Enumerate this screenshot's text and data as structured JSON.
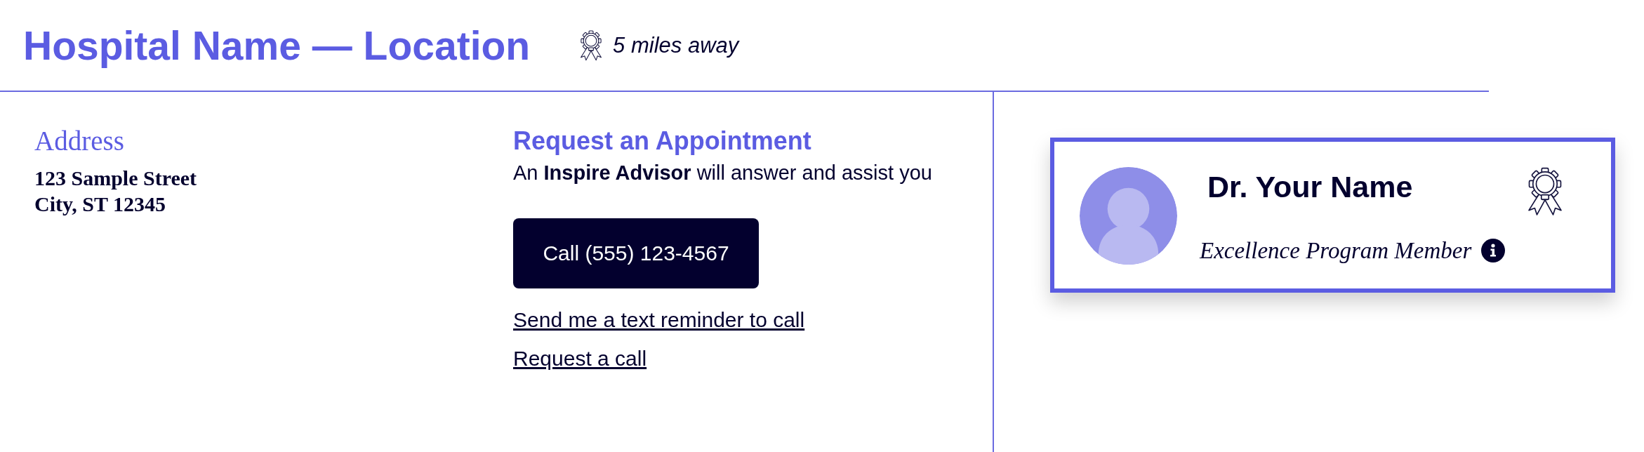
{
  "header": {
    "title": "Hospital Name — Location",
    "distance": "5 miles away"
  },
  "address": {
    "heading": "Address",
    "lines": [
      "123 Sample Street",
      "City, ST 12345"
    ]
  },
  "appointment": {
    "heading": "Request an Appointment",
    "subtitle": "An **Inspire Advisor** will answer and assist you",
    "call_button": "Call (555) 123-4567",
    "links": [
      "Send me a text reminder to call",
      "Request a call"
    ]
  },
  "provider_card": {
    "name": "Dr. Your Name",
    "program": "Excellence Program Member"
  }
}
